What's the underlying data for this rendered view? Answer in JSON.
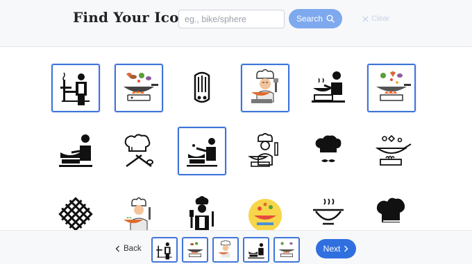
{
  "header": {
    "title": "Find Your Icon",
    "search_placeholder": "eg., bike/sphere",
    "search_label": "Search",
    "clear_label": "Clear"
  },
  "icons": [
    {
      "name": "grill-chef-icon",
      "selected": true
    },
    {
      "name": "wok-flames-color-icon",
      "selected": true
    },
    {
      "name": "oven-mitt-icon",
      "selected": false
    },
    {
      "name": "chef-cooking-color-icon",
      "selected": true
    },
    {
      "name": "cook-stove-icon",
      "selected": false
    },
    {
      "name": "wok-veggies-color-icon",
      "selected": true
    },
    {
      "name": "cook-pot-icon",
      "selected": false
    },
    {
      "name": "chef-hat-utensils-icon",
      "selected": false
    },
    {
      "name": "cook-stir-icon",
      "selected": true
    },
    {
      "name": "chef-stirring-outline-icon",
      "selected": false
    },
    {
      "name": "chef-hat-mustache-icon",
      "selected": false
    },
    {
      "name": "pan-flip-outline-icon",
      "selected": false
    },
    {
      "name": "grill-grate-icon",
      "selected": false
    },
    {
      "name": "chef-serving-color-icon",
      "selected": false
    },
    {
      "name": "chef-spatula-icon",
      "selected": false
    },
    {
      "name": "pasta-bowl-color-icon",
      "selected": false
    },
    {
      "name": "hot-bowl-icon",
      "selected": false
    },
    {
      "name": "chef-hat-icon",
      "selected": false
    }
  ],
  "footer": {
    "back_label": "Back",
    "next_label": "Next",
    "selected_thumbs": [
      "grill-chef-icon",
      "wok-flames-color-icon",
      "chef-cooking-color-icon",
      "cook-stir-icon",
      "wok-veggies-color-icon"
    ]
  },
  "colors": {
    "accent": "#2f6fe0",
    "accent_light": "#7ea9ef",
    "selection_border": "#3f74d9"
  }
}
